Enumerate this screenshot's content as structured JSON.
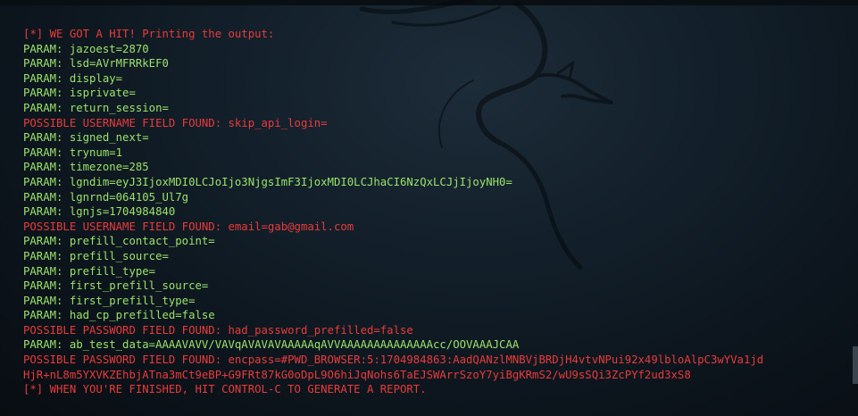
{
  "terminal": {
    "lines": [
      {
        "text": "[*] WE GOT A HIT! Printing the output:",
        "color": "red"
      },
      {
        "text": "PARAM: jazoest=2870",
        "color": "green"
      },
      {
        "text": "PARAM: lsd=AVrMFRRkEF0",
        "color": "green"
      },
      {
        "text": "PARAM: display=",
        "color": "green"
      },
      {
        "text": "PARAM: isprivate=",
        "color": "green"
      },
      {
        "text": "PARAM: return_session=",
        "color": "green"
      },
      {
        "text": "POSSIBLE USERNAME FIELD FOUND: skip_api_login=",
        "color": "red"
      },
      {
        "text": "PARAM: signed_next=",
        "color": "green"
      },
      {
        "text": "PARAM: trynum=1",
        "color": "green"
      },
      {
        "text": "PARAM: timezone=285",
        "color": "green"
      },
      {
        "text": "PARAM: lgndim=eyJ3IjoxMDI0LCJoIjo3NjgsImF3IjoxMDI0LCJhaCI6NzQxLCJjIjoyNH0=",
        "color": "green"
      },
      {
        "text": "PARAM: lgnrnd=064105_Ul7g",
        "color": "green"
      },
      {
        "text": "PARAM: lgnjs=1704984840",
        "color": "green"
      },
      {
        "text": "POSSIBLE USERNAME FIELD FOUND: email=gab@gmail.com",
        "color": "red"
      },
      {
        "text": "PARAM: prefill_contact_point=",
        "color": "green"
      },
      {
        "text": "PARAM: prefill_source=",
        "color": "green"
      },
      {
        "text": "PARAM: prefill_type=",
        "color": "green"
      },
      {
        "text": "PARAM: first_prefill_source=",
        "color": "green"
      },
      {
        "text": "PARAM: first_prefill_type=",
        "color": "green"
      },
      {
        "text": "PARAM: had_cp_prefilled=false",
        "color": "green"
      },
      {
        "text": "POSSIBLE PASSWORD FIELD FOUND: had_password_prefilled=false",
        "color": "red"
      },
      {
        "text": "PARAM: ab_test_data=AAAAVAVV/VAVqAVAVAVAAAAAqAVVAAAAAAAAAAAAAAcc/OOVAAAJCAA",
        "color": "green"
      },
      {
        "text": "POSSIBLE PASSWORD FIELD FOUND: encpass=#PWD_BROWSER:5:1704984863:AadQANzlMNBVjBRDjH4vtvNPui92x49lbloAlpC3wYVa1jd",
        "color": "red"
      },
      {
        "text": "HjR+nL8m5YXVKZEhbjATna3mCt9eBP+G9FRt87kG0oDpL9O6hiJqNohs6TaEJSWArrSzoY7yiBgKRmS2/wU9sSQi3ZcPYf2ud3xS8",
        "color": "red"
      },
      {
        "text": "[*] WHEN YOU'RE FINISHED, HIT CONTROL-C TO GENERATE A REPORT.",
        "color": "red"
      }
    ]
  },
  "colors": {
    "green": "#9be36a",
    "red": "#ea3a3a",
    "background": "#13202b"
  },
  "background_icon": "kali-dragon-icon"
}
